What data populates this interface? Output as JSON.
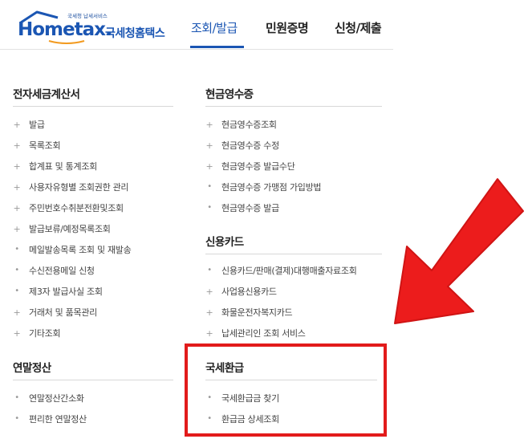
{
  "header": {
    "logo_tagline": "국세청 납세서비스",
    "logo_text": "Hometax.",
    "logo_ko": "국세청홈택스",
    "tabs": [
      "조회/발급",
      "민원증명",
      "신청/제출"
    ],
    "active_tab": "조회/발급"
  },
  "menu": {
    "e_invoice": {
      "title": "전자세금계산서",
      "items": [
        "발급",
        "목록조회",
        "합계표 및 통계조회",
        "사용자유형별 조회권한 관리",
        "주민번호수취분전환및조회",
        "발급보류/예정목록조회",
        "메일발송목록 조회 및 재발송",
        "수신전용메일 신청",
        "제3자 발급사실 조회",
        "거래처 및 품목관리",
        "기타조회"
      ]
    },
    "cash_receipt": {
      "title": "현금영수증",
      "items": [
        "현금영수증조회",
        "현금영수증 수정",
        "현금영수증 발급수단",
        "현금영수증 가맹점 가입방법",
        "현금영수증 발급"
      ]
    },
    "credit_card": {
      "title": "신용카드",
      "items": [
        "신용카드/판매(결제)대행매출자료조회",
        "사업용신용카드",
        "화물운전자복지카드",
        "납세관리인 조회 서비스"
      ]
    },
    "year_end": {
      "title": "연말정산",
      "items": [
        "연말정산간소화",
        "편리한 연말정산"
      ]
    },
    "refund": {
      "title": "국세환급",
      "items": [
        "국세환급금 찾기",
        "환급금 상세조회"
      ]
    }
  },
  "colors": {
    "brand": "#1b56b3",
    "annotation": "#e21b1b"
  }
}
